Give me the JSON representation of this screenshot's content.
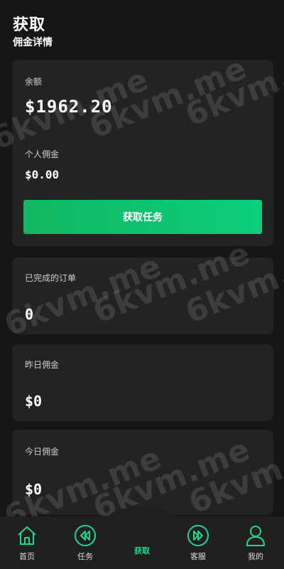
{
  "header": {
    "title": "获取",
    "subtitle": "佣金详情"
  },
  "balance": {
    "label": "余额",
    "value": "$1962.20"
  },
  "personal_commission": {
    "label": "个人佣金",
    "value": "$0.00"
  },
  "get_task_button": "获取任务",
  "stats": [
    {
      "label": "已完成的订单",
      "value": "0"
    },
    {
      "label": "昨日佣金",
      "value": "$0"
    },
    {
      "label": "今日佣金",
      "value": "$0"
    }
  ],
  "watermark": "6kvm.me",
  "tabs": [
    {
      "label": "首页",
      "icon": "home-icon"
    },
    {
      "label": "任务",
      "icon": "rewind-icon"
    },
    {
      "label": "获取",
      "icon": "none"
    },
    {
      "label": "客服",
      "icon": "fast-forward-icon"
    },
    {
      "label": "我的",
      "icon": "user-icon"
    }
  ],
  "colors": {
    "accent": "#12c26c",
    "active_tab": "#1fd88b",
    "card": "#232323",
    "background": "#161616"
  }
}
